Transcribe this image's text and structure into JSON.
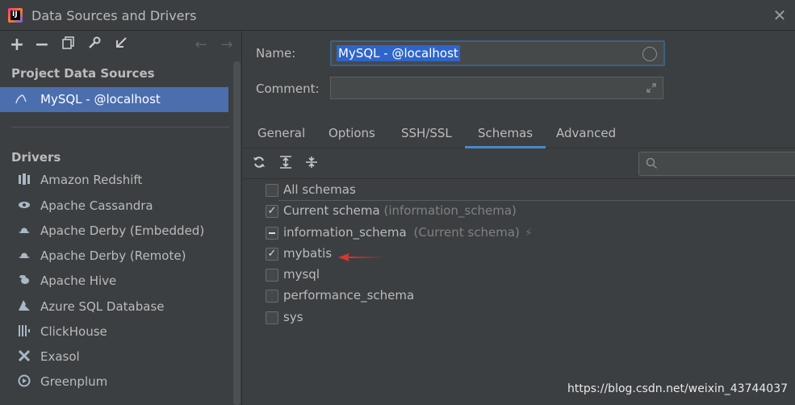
{
  "window": {
    "title": "Data Sources and Drivers",
    "close": "✕"
  },
  "toolbar": {
    "add": "+",
    "remove": "−",
    "copy": "⧉",
    "edit": "🔧",
    "import": "↙",
    "back": "←",
    "forward": "→"
  },
  "sidebar": {
    "project_heading": "Project Data Sources",
    "data_source": "MySQL - @localhost",
    "drivers_heading": "Drivers",
    "drivers": [
      {
        "label": "Amazon Redshift",
        "icon": "redshift-icon"
      },
      {
        "label": "Apache Cassandra",
        "icon": "cassandra-icon"
      },
      {
        "label": "Apache Derby (Embedded)",
        "icon": "derby-icon"
      },
      {
        "label": "Apache Derby (Remote)",
        "icon": "derby-icon"
      },
      {
        "label": "Apache Hive",
        "icon": "hive-icon"
      },
      {
        "label": "Azure SQL Database",
        "icon": "azure-icon"
      },
      {
        "label": "ClickHouse",
        "icon": "clickhouse-icon"
      },
      {
        "label": "Exasol",
        "icon": "exasol-icon"
      },
      {
        "label": "Greenplum",
        "icon": "greenplum-icon"
      }
    ]
  },
  "form": {
    "name_label": "Name:",
    "name_value": "MySQL - @localhost",
    "comment_label": "Comment:",
    "comment_value": ""
  },
  "tabs": [
    "General",
    "Options",
    "SSH/SSL",
    "Schemas",
    "Advanced"
  ],
  "active_tab": "Schemas",
  "schemas": {
    "all_label": "All schemas",
    "items": [
      {
        "name": "Current schema",
        "hint": "(information_schema)",
        "state": "checked"
      },
      {
        "name": "information_schema",
        "hint": "(Current schema)",
        "state": "partial",
        "bolt": "⚡"
      },
      {
        "name": "mybatis",
        "hint": "",
        "state": "checked"
      },
      {
        "name": "mysql",
        "hint": "",
        "state": "unchecked"
      },
      {
        "name": "performance_schema",
        "hint": "",
        "state": "unchecked"
      },
      {
        "name": "sys",
        "hint": "",
        "state": "unchecked"
      }
    ]
  },
  "watermark": "https://blog.csdn.net/weixin_43744037",
  "colors": {
    "selection": "#4b6eaf",
    "tab_underline": "#4a88c7",
    "arrow": "#e0342f",
    "background": "#3c3f41"
  }
}
